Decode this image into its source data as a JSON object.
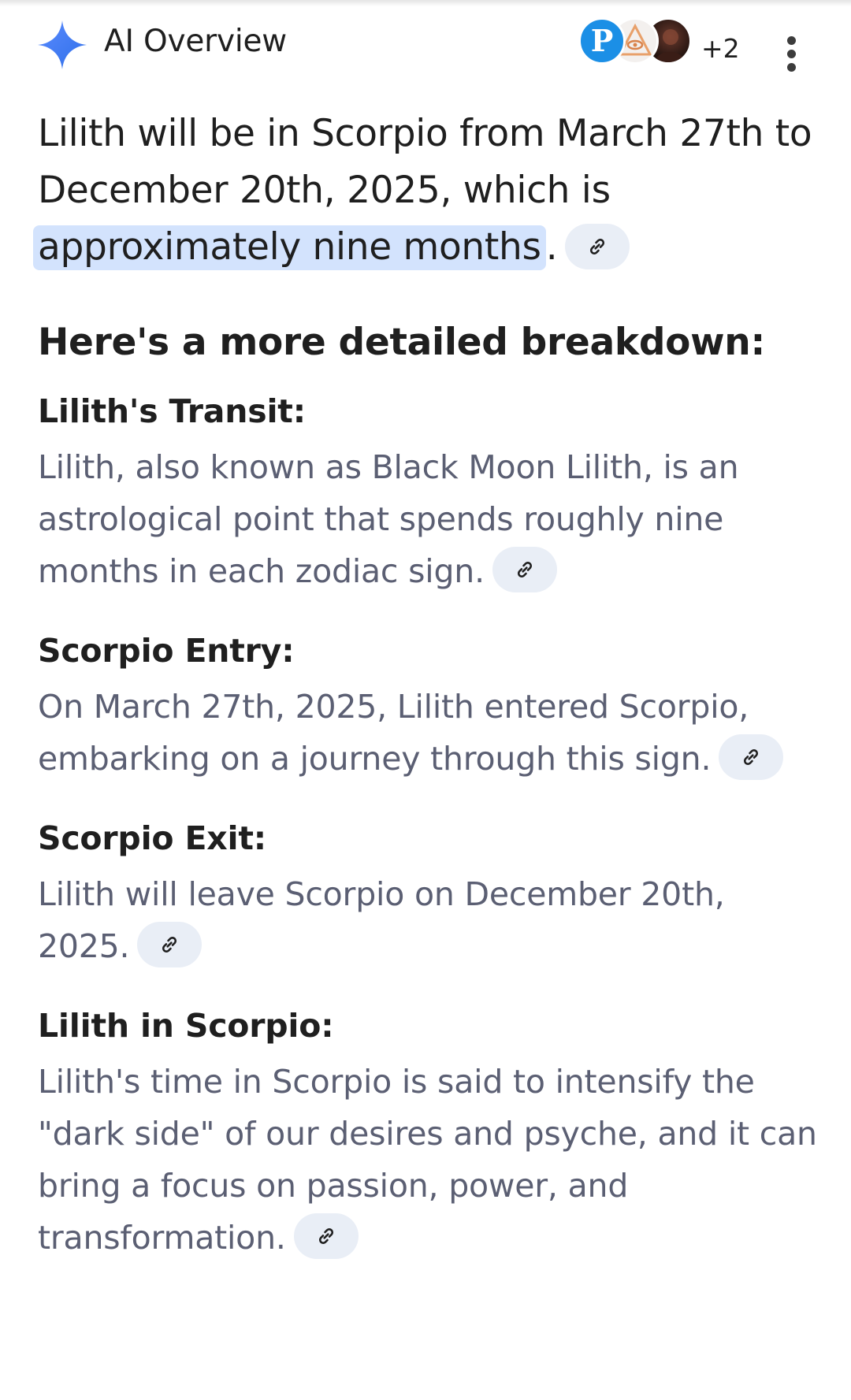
{
  "header": {
    "title": "AI Overview",
    "source_avatars": [
      {
        "name": "avatar-p",
        "letter": "P"
      },
      {
        "name": "avatar-eye"
      },
      {
        "name": "avatar-dark"
      }
    ],
    "more_sources": "+2",
    "sparkle_color": "#4285f4"
  },
  "lead": {
    "text_before": "Lilith will be in Scorpio from March 27th to December 20th, 2025, which is ",
    "highlight": "approximately nine months",
    "text_after": "."
  },
  "breakdown_heading": "Here's a more detailed breakdown:",
  "blocks": [
    {
      "title": "Lilith's Transit:",
      "text": "Lilith, also known as Black Moon Lilith, is an astrological point that spends roughly nine months in each zodiac sign."
    },
    {
      "title": "Scorpio Entry:",
      "text": "On March 27th, 2025, Lilith entered Scorpio, embarking on a journey through this sign."
    },
    {
      "title": "Scorpio Exit:",
      "text": "Lilith will leave Scorpio on December 20th, 2025."
    },
    {
      "title": "Lilith in Scorpio:",
      "text": "Lilith's time in Scorpio is said to intensify the \"dark side\" of our desires and psyche, and it can bring a focus on passion, power, and transformation."
    }
  ],
  "colors": {
    "highlight": "#d3e3fd",
    "chip": "#e9eef6",
    "body_text": "#5b5f73",
    "heading_text": "#1f1f1f"
  },
  "icons": {
    "sparkle": "sparkle-icon",
    "link": "link-icon",
    "menu": "more-vert-icon"
  }
}
